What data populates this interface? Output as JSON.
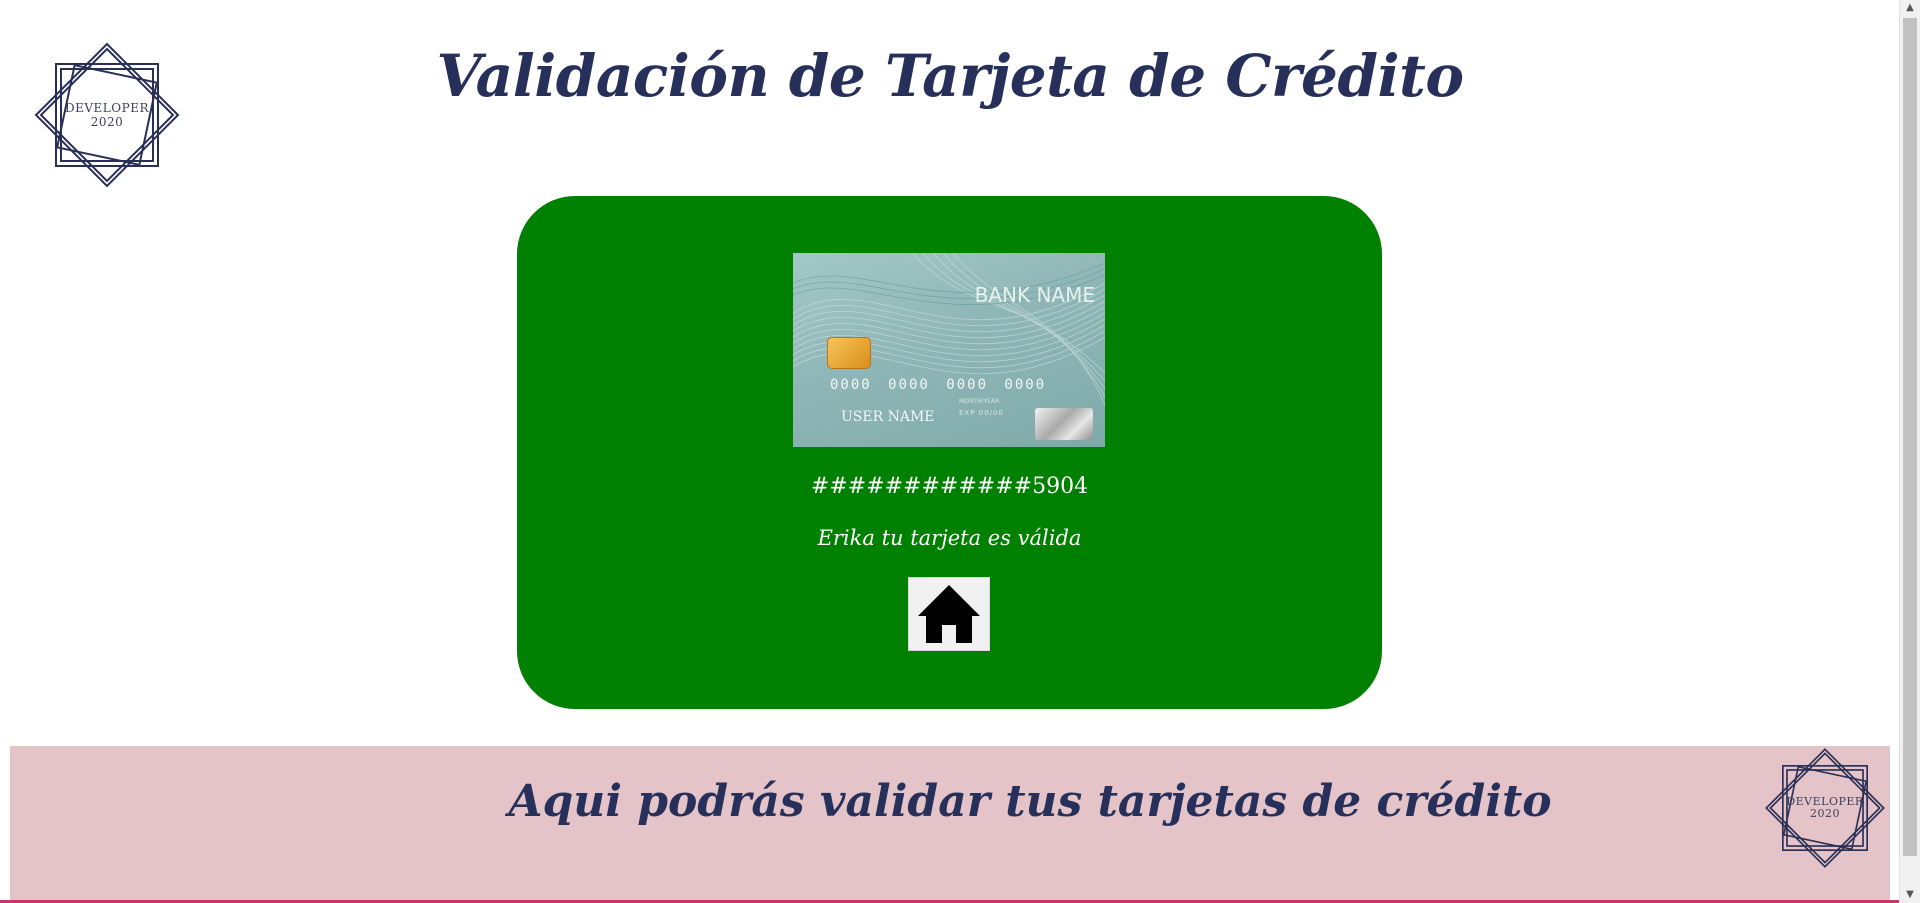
{
  "header": {
    "title": "Validación de Tarjeta de Crédito",
    "logo": {
      "line1": "DEVELOPER",
      "line2": "2020"
    }
  },
  "result": {
    "card_image": {
      "bank_name": "BANK NAME",
      "number": "0000 0000 0000 0000",
      "user_name": "USER NAME",
      "exp_small": "MONTH/YEAR",
      "exp": "EXP  00/00"
    },
    "masked_number": "############5904",
    "message": "Erika tu tarjeta es válida",
    "home_button_icon": "home-icon"
  },
  "footer": {
    "text": "Aqui podrás validar tus tarjetas de crédito",
    "logo": {
      "line1": "DEVELOPER",
      "line2": "2020"
    }
  },
  "colors": {
    "title": "#27305a",
    "panel": "#008000",
    "footer": "#e4c4c8",
    "footer_line": "#c8356a"
  }
}
